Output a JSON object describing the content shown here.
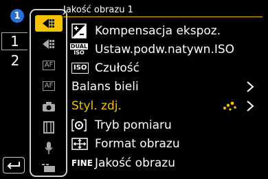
{
  "header": {
    "title": "Jakość obrazu 1"
  },
  "pages": {
    "badge": "1",
    "tab1": "1",
    "tab2": "2"
  },
  "menu": [
    {
      "label": "Kompensacja ekspoz.",
      "icon": "exposure-compensation-icon"
    },
    {
      "label": "Ustaw.podw.natywn.ISO",
      "icon": "dual-iso-icon",
      "badge_top": "DUAL",
      "badge_bottom": "ISO"
    },
    {
      "label": "Czułość",
      "icon": "iso-icon",
      "badge": "ISO"
    },
    {
      "label": "Balans bieli",
      "icon": ""
    },
    {
      "label": "Styl. zdj.",
      "icon": ""
    },
    {
      "label": "Tryb pomiaru",
      "icon": "metering-mode-icon"
    },
    {
      "label": "Format obrazu",
      "icon": "aspect-ratio-icon"
    },
    {
      "label": "Jakość obrazu",
      "icon": "fine-quality-icon",
      "badge": "FINE"
    }
  ],
  "sidebar": {
    "icons": [
      "photo-quality-icon-active",
      "photo-quality-icon",
      "af-icon",
      "af-custom-icon",
      "camera-icon",
      "film-icon",
      "microphone-icon",
      "video-camera-icon"
    ],
    "af1": "AF",
    "af2": "AF"
  },
  "colors": {
    "accent": "#f3c300",
    "badge_blue": "#2a6fd8"
  }
}
